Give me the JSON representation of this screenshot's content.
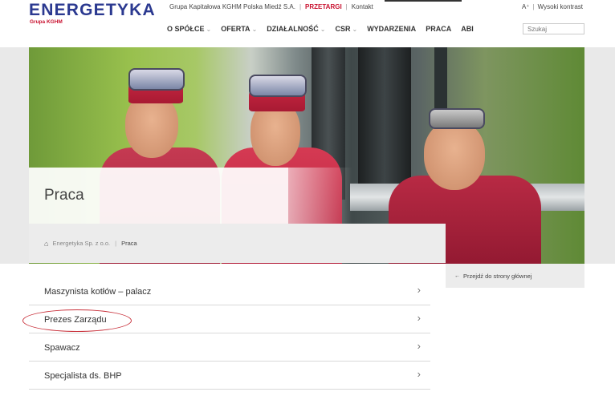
{
  "brand": {
    "name": "ENERGETYKA",
    "sub_prefix": "Grupa ",
    "sub_highlight": "KGHM"
  },
  "topbar": {
    "group": "Grupa Kapitałowa KGHM Polska Miedź S.A.",
    "tenders": "PRZETARGI",
    "contact": "Kontakt"
  },
  "accessibility": {
    "font_size": "A⁺",
    "contrast": "Wysoki kontrast"
  },
  "nav": {
    "items": [
      {
        "label": "O SPÓŁCE",
        "has_menu": true
      },
      {
        "label": "OFERTA",
        "has_menu": true
      },
      {
        "label": "DZIAŁALNOŚĆ",
        "has_menu": true
      },
      {
        "label": "CSR",
        "has_menu": true
      },
      {
        "label": "WYDARZENIA",
        "has_menu": false
      },
      {
        "label": "PRACA",
        "has_menu": false
      },
      {
        "label": "ABI",
        "has_menu": false
      }
    ]
  },
  "search": {
    "placeholder": "Szukaj"
  },
  "page": {
    "title": "Praca"
  },
  "breadcrumb": {
    "home": "Energetyka Sp. z o.o.",
    "current": "Praca"
  },
  "side": {
    "back_link": "Przejdź do strony głównej"
  },
  "jobs": [
    {
      "label": "Maszynista kotłów – palacz"
    },
    {
      "label": "Prezes Zarządu"
    },
    {
      "label": "Spawacz"
    },
    {
      "label": "Specjalista ds. BHP"
    }
  ],
  "icons": {
    "home": "home-icon",
    "chevron": "chevron-right-icon",
    "back": "arrow-left-icon"
  },
  "colors": {
    "brand_blue": "#2b3990",
    "accent_red": "#c8102e",
    "annotation": "#c8303a"
  }
}
